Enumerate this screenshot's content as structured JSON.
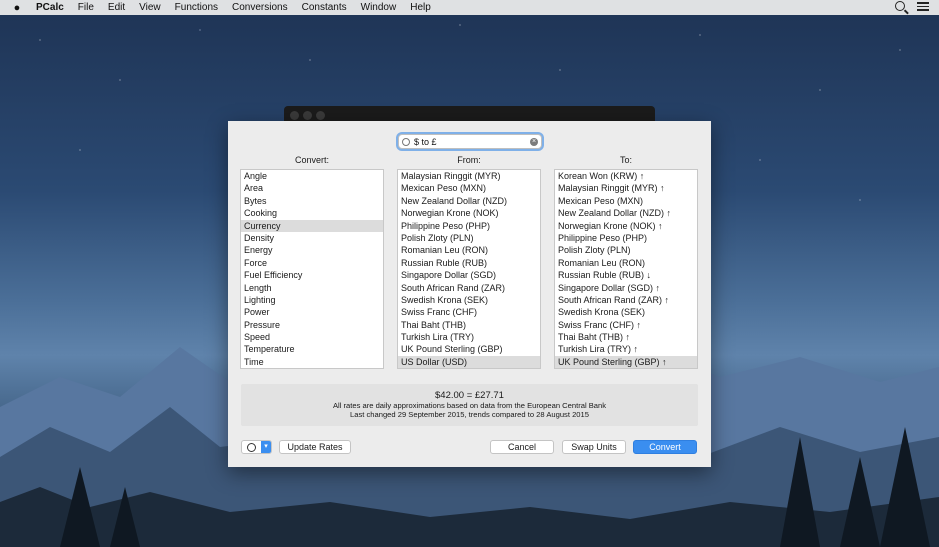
{
  "menubar": {
    "app": "PCalc",
    "items": [
      "File",
      "Edit",
      "View",
      "Functions",
      "Conversions",
      "Constants",
      "Window",
      "Help"
    ]
  },
  "search": {
    "value": "$ to £"
  },
  "columns": {
    "convert": "Convert:",
    "from": "From:",
    "to": "To:"
  },
  "convert_list": [
    "Angle",
    "Area",
    "Bytes",
    "Cooking",
    "Currency",
    "Density",
    "Energy",
    "Force",
    "Fuel Efficiency",
    "Length",
    "Lighting",
    "Power",
    "Pressure",
    "Speed",
    "Temperature",
    "Time"
  ],
  "convert_selected": 4,
  "from_list": [
    "Malaysian Ringgit (MYR)",
    "Mexican Peso (MXN)",
    "New Zealand Dollar (NZD)",
    "Norwegian Krone (NOK)",
    "Philippine Peso (PHP)",
    "Polish Zloty (PLN)",
    "Romanian Leu (RON)",
    "Russian Ruble (RUB)",
    "Singapore Dollar (SGD)",
    "South African Rand (ZAR)",
    "Swedish Krona (SEK)",
    "Swiss Franc (CHF)",
    "Thai Baht (THB)",
    "Turkish Lira (TRY)",
    "UK Pound Sterling (GBP)",
    "US Dollar (USD)"
  ],
  "from_selected": 15,
  "to_list": [
    "Korean Won (KRW) ↑",
    "Malaysian Ringgit (MYR) ↑",
    "Mexican Peso (MXN)",
    "New Zealand Dollar (NZD) ↑",
    "Norwegian Krone (NOK) ↑",
    "Philippine Peso (PHP)",
    "Polish Zloty (PLN)",
    "Romanian Leu (RON)",
    "Russian Ruble (RUB) ↓",
    "Singapore Dollar (SGD) ↑",
    "South African Rand (ZAR) ↑",
    "Swedish Krona (SEK)",
    "Swiss Franc (CHF) ↑",
    "Thai Baht (THB) ↑",
    "Turkish Lira (TRY) ↑",
    "UK Pound Sterling (GBP) ↑"
  ],
  "to_selected": 15,
  "info": {
    "result": "$42.00 = £27.71",
    "note1": "All rates are daily approximations based on data from the European Central Bank",
    "note2": "Last changed 29 September 2015, trends compared to 28 August 2015"
  },
  "buttons": {
    "update": "Update Rates",
    "cancel": "Cancel",
    "swap": "Swap Units",
    "convert": "Convert"
  },
  "icons": {
    "apple": "apple-logo-icon",
    "spotlight": "search-icon",
    "notifications": "list-icon",
    "gear": "gear-icon"
  },
  "colors": {
    "accent": "#3a8ef0",
    "selection": "#dcdcdc"
  }
}
